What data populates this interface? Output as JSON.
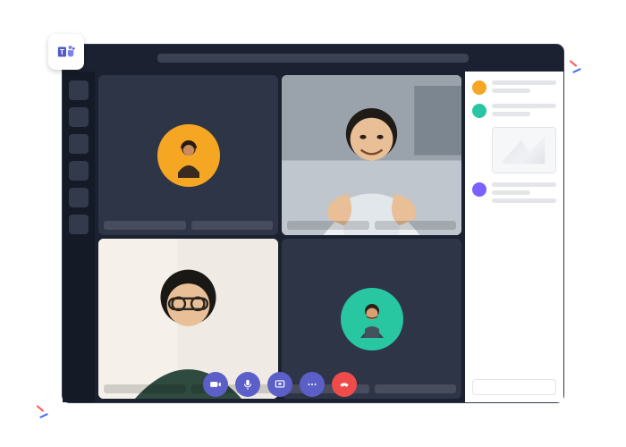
{
  "app": {
    "name": "Microsoft Teams"
  },
  "colors": {
    "accent": "#5b5fc7",
    "danger": "#ef4b4b",
    "avatar_orange": "#f5a623",
    "avatar_teal": "#28c7a2"
  },
  "sidebar": {
    "items": [
      {
        "id": "activity"
      },
      {
        "id": "chat"
      },
      {
        "id": "teams"
      },
      {
        "id": "calendar"
      },
      {
        "id": "calls"
      },
      {
        "id": "files"
      }
    ]
  },
  "call": {
    "participants": [
      {
        "id": "p1",
        "display": "avatar_only",
        "avatar_bg": "#f5a623"
      },
      {
        "id": "p2",
        "display": "video"
      },
      {
        "id": "p3",
        "display": "video"
      },
      {
        "id": "p4",
        "display": "avatar_only",
        "avatar_bg": "#28c7a2"
      }
    ],
    "controls": [
      {
        "id": "camera",
        "icon": "camera-icon",
        "kind": "primary"
      },
      {
        "id": "mic",
        "icon": "mic-icon",
        "kind": "primary"
      },
      {
        "id": "share",
        "icon": "share-icon",
        "kind": "primary"
      },
      {
        "id": "more",
        "icon": "more-icon",
        "kind": "primary"
      },
      {
        "id": "hangup",
        "icon": "hangup-icon",
        "kind": "danger"
      }
    ]
  },
  "chat": {
    "messages": [
      {
        "avatar_color": "#f5a623"
      },
      {
        "avatar_color": "#28c7a2",
        "has_attachment": true
      },
      {
        "avatar_color": "#7b61ff"
      }
    ]
  }
}
